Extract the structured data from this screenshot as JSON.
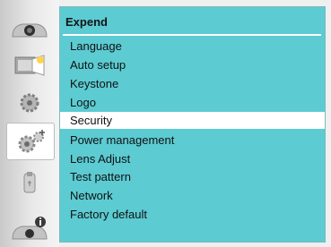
{
  "menu": {
    "title": "Expend",
    "items": [
      {
        "label": "Language",
        "selected": false
      },
      {
        "label": "Auto setup",
        "selected": false
      },
      {
        "label": "Keystone",
        "selected": false
      },
      {
        "label": "Logo",
        "selected": false
      },
      {
        "label": "Security",
        "selected": true
      },
      {
        "label": "Power management",
        "selected": false
      },
      {
        "label": "Lens Adjust",
        "selected": false
      },
      {
        "label": "Test pattern",
        "selected": false
      },
      {
        "label": "Network",
        "selected": false
      },
      {
        "label": "Factory default",
        "selected": false
      }
    ]
  },
  "sidebar": {
    "icons": [
      {
        "icon": "display-icon",
        "selected": false
      },
      {
        "icon": "picture-adjust-icon",
        "selected": false
      },
      {
        "icon": "setting-gear-icon",
        "selected": false
      },
      {
        "icon": "expand-gear-icon",
        "selected": true
      },
      {
        "icon": "memory-viewer-icon",
        "selected": false
      },
      {
        "icon": "info-icon",
        "selected": false
      }
    ]
  },
  "colors": {
    "panel": "#5ccbd2",
    "highlight": "#ffffff",
    "text": "#111111"
  }
}
